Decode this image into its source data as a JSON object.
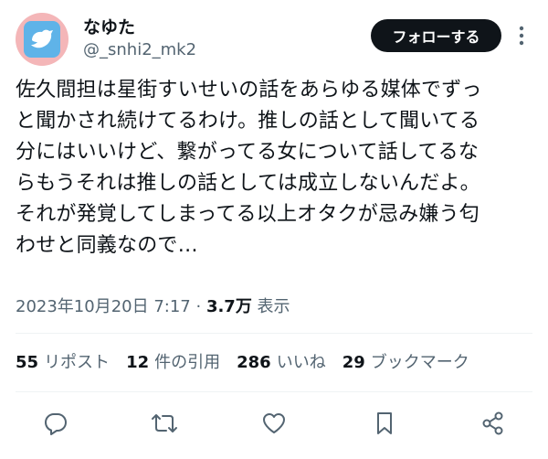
{
  "author": {
    "display_name": "なゆた",
    "handle": "@_snhi2_mk2",
    "avatar_icon": "bird-icon"
  },
  "header": {
    "follow_label": "フォローする",
    "more_icon": "more-vertical-icon"
  },
  "tweet": {
    "lines": [
      "佐久間担は星街すいせいの話をあらゆる媒体でずっ",
      "と聞かされ続けてるわけ。推しの話として聞いてる",
      "分にはいいけど、繋がってる女について話してるな",
      "らもうそれは推しの話としては成立しないんだよ。",
      "それが発覚してしまってる以上オタクが忌み嫌う匂",
      "わせと同義なので…"
    ]
  },
  "meta": {
    "timestamp": "2023年10月20日 7:17",
    "separator": " · ",
    "views_count": "3.7万",
    "views_label": " 表示"
  },
  "stats": [
    {
      "count": "55",
      "label": "リポスト"
    },
    {
      "count": "12",
      "label": "件の引用"
    },
    {
      "count": "286",
      "label": "いいね"
    },
    {
      "count": "29",
      "label": "ブックマーク"
    }
  ],
  "colors": {
    "text_primary": "#0f1419",
    "text_secondary": "#536471",
    "divider": "#eff3f4",
    "avatar_bg": "#f4b6b8",
    "avatar_inner": "#5fb3e8"
  }
}
